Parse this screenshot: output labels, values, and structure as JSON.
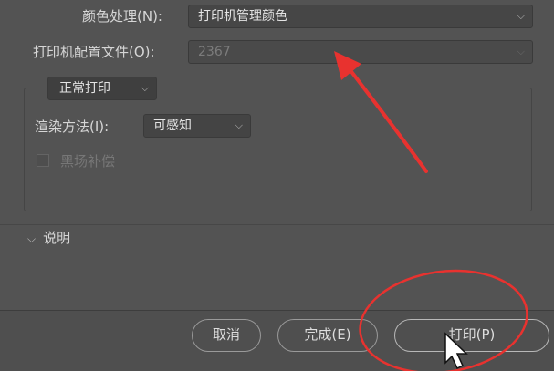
{
  "color_handling": {
    "label": "颜色处理(N):",
    "value": "打印机管理颜色"
  },
  "printer_profile": {
    "label": "打印机配置文件(O):",
    "value": "2367"
  },
  "proof_setup": {
    "dropdown_value": "正常打印",
    "rendering_intent": {
      "label": "渲染方法(I):",
      "value": "可感知"
    },
    "black_point_compensation": {
      "label": "黑场补偿",
      "checked": false,
      "enabled": false
    }
  },
  "description_section": {
    "label": "说明"
  },
  "buttons": {
    "cancel": "取消",
    "done": "完成(E)",
    "print": "打印(P)"
  },
  "annotations": {
    "arrow_color": "#e8322f",
    "circle_color": "#e8322f"
  },
  "icons": {
    "chevron": "chevron-down-icon",
    "cursor": "mouse-pointer-icon"
  }
}
